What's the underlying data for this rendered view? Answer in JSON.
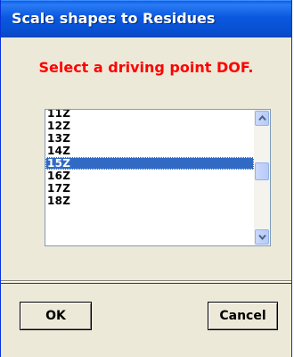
{
  "window": {
    "title": "Scale shapes to Residues"
  },
  "prompt": "Select a driving point DOF.",
  "dof_list": {
    "items": [
      "11Z",
      "12Z",
      "13Z",
      "14Z",
      "15Z",
      "16Z",
      "17Z",
      "18Z"
    ],
    "selected": "15Z"
  },
  "buttons": {
    "ok_label": "OK",
    "cancel_label": "Cancel"
  },
  "colors": {
    "title_bar": "#0a58df",
    "prompt_text": "#ff0000",
    "selection": "#316ac5"
  }
}
